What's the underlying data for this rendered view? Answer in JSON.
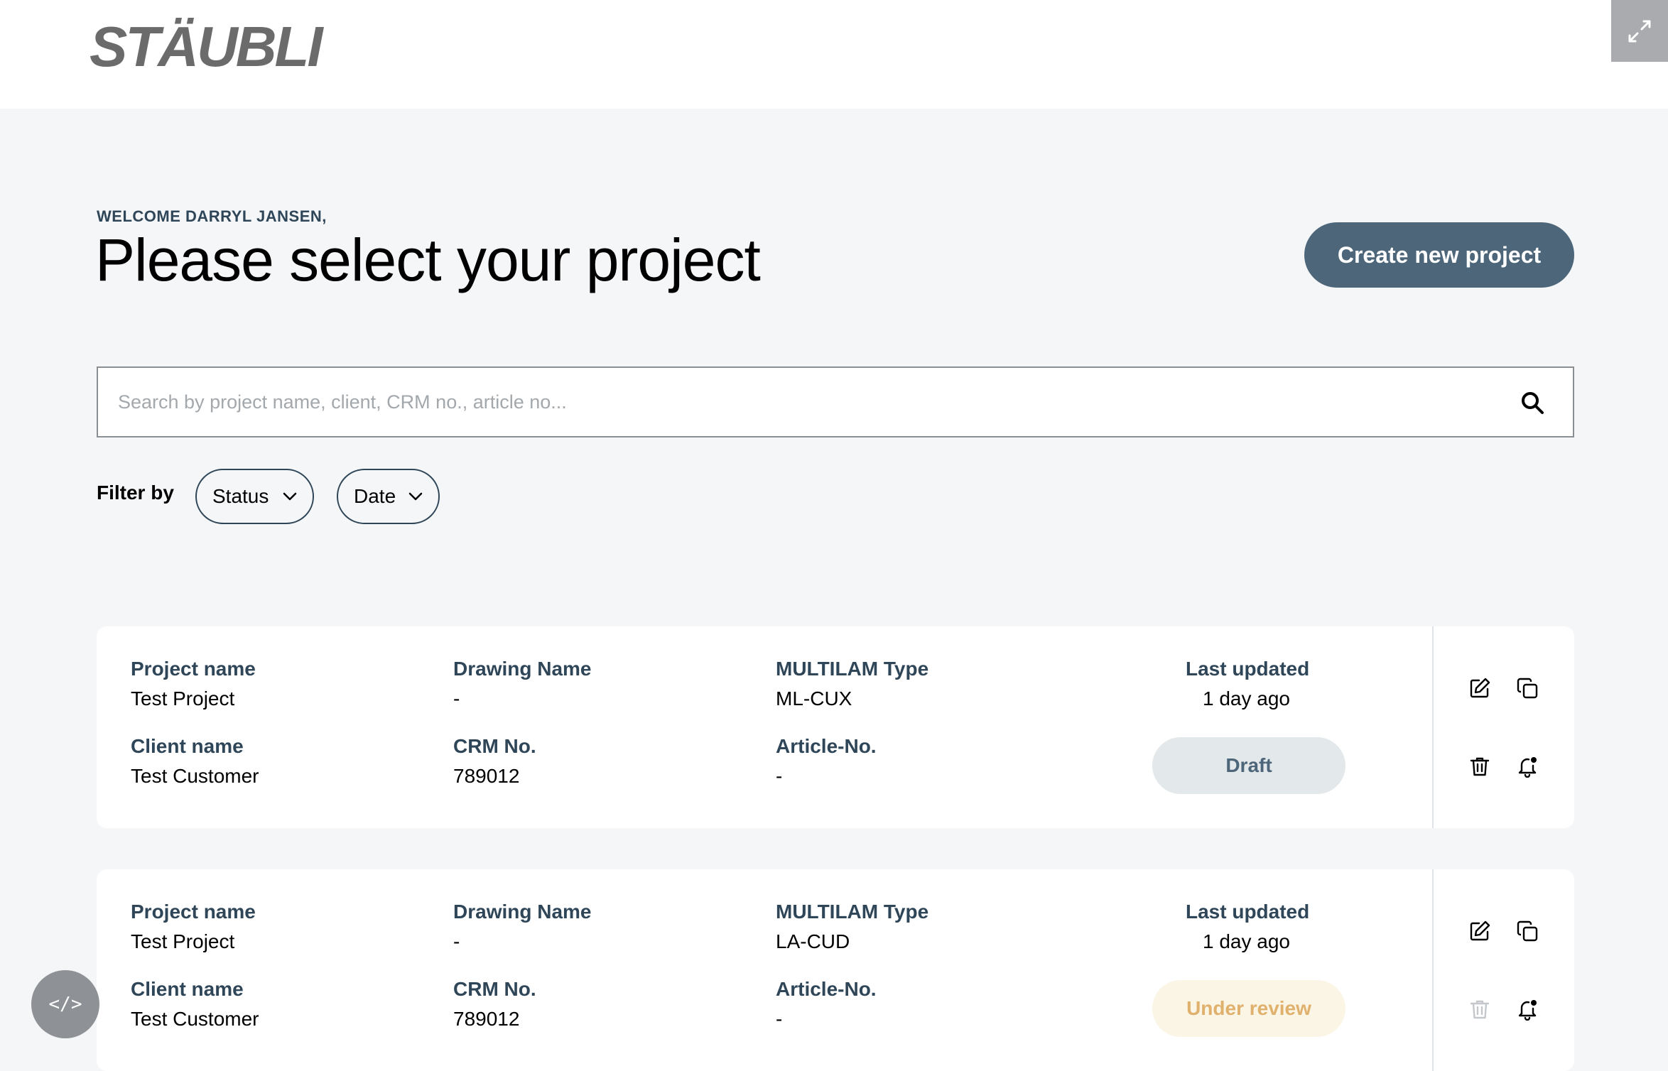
{
  "header": {
    "logo_text": "STÄUBLI",
    "expand_icon": "expand-arrows-icon"
  },
  "main": {
    "welcome": "WELCOME DARRYL JANSEN,",
    "title": "Please select your project",
    "create_button": "Create new project"
  },
  "search": {
    "placeholder": "Search by project name, client, CRM no., article no...",
    "value": "",
    "icon": "search-icon"
  },
  "filters": {
    "label": "Filter by",
    "items": [
      {
        "label": "Status"
      },
      {
        "label": "Date"
      }
    ]
  },
  "labels": {
    "project_name": "Project name",
    "client_name": "Client name",
    "drawing_name": "Drawing Name",
    "crm_no": "CRM No.",
    "multilam_type": "MULTILAM Type",
    "article_no": "Article-No.",
    "last_updated": "Last updated"
  },
  "projects": [
    {
      "project_name": "Test Project",
      "client_name": "Test Customer",
      "drawing_name": "-",
      "crm_no": "789012",
      "multilam_type": "ML-CUX",
      "article_no": "-",
      "last_updated": "1 day ago",
      "status": "Draft",
      "status_color": "#4d6679",
      "delete_enabled": true
    },
    {
      "project_name": "Test Project",
      "client_name": "Test Customer",
      "drawing_name": "-",
      "crm_no": "789012",
      "multilam_type": "LA-CUD",
      "article_no": "-",
      "last_updated": "1 day ago",
      "status": "Under review",
      "status_color": "#e0b06d",
      "delete_enabled": false
    }
  ],
  "dev_tools": {
    "label": "</>"
  },
  "colors": {
    "accent": "#4d6679",
    "label": "#2f4658",
    "background": "#f5f6f8"
  }
}
